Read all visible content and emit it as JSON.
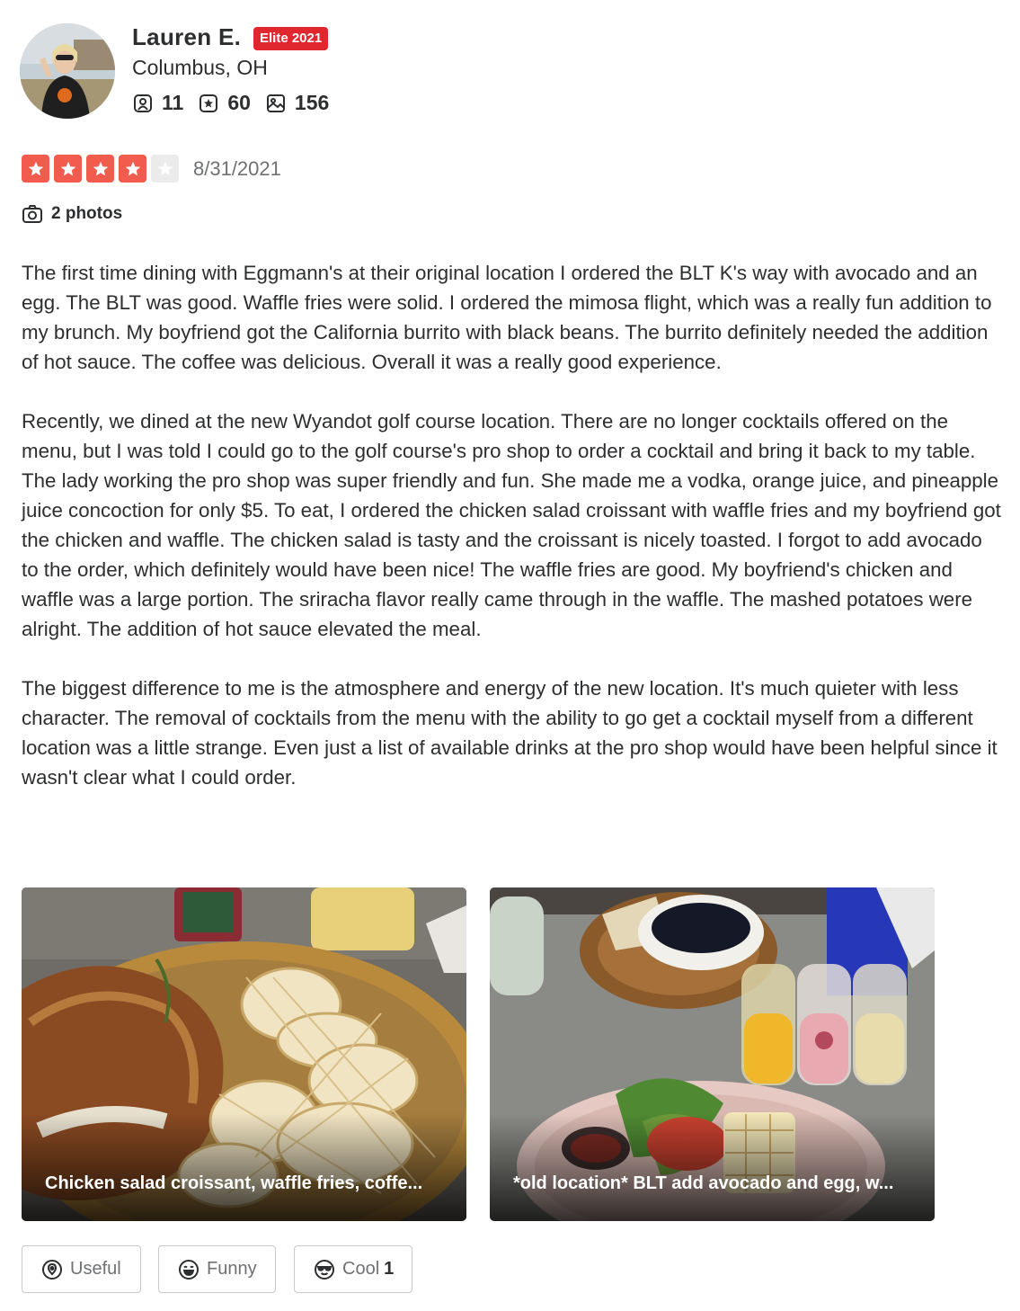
{
  "user": {
    "name": "Lauren E.",
    "badge": "Elite 2021",
    "location": "Columbus, OH",
    "friends": "11",
    "reviews": "60",
    "photos": "156"
  },
  "review": {
    "rating": 4,
    "rating_max": 5,
    "date": "8/31/2021",
    "photos_label": "2 photos",
    "paragraphs": [
      "The first time dining with Eggmann's at their original location I ordered the BLT K's way with avocado and an egg. The BLT was good. Waffle fries were solid. I ordered the mimosa flight, which was a really fun addition to my brunch. My boyfriend got the California burrito with black beans. The burrito definitely needed the addition of hot sauce. The coffee was delicious. Overall it was a really good experience.",
      "Recently, we dined at the new Wyandot golf course location. There are no longer cocktails offered on the menu, but I was told I could go to the golf course's pro shop to order a cocktail and bring it back to my table. The lady working the pro shop was super friendly and fun. She made me a vodka, orange juice, and pineapple juice concoction for only $5. To eat, I ordered the chicken salad croissant with waffle fries and my boyfriend got the chicken and waffle. The chicken salad is tasty and the croissant is nicely toasted. I forgot to add avocado to the order, which definitely would have been nice! The waffle fries are good. My boyfriend's chicken and waffle was a large portion. The sriracha flavor really came through in the waffle. The mashed potatoes were alright. The addition of hot sauce elevated the meal.",
      "The biggest difference to me is the atmosphere and energy of the new location. It's much quieter with less character. The removal of cocktails from the menu with the ability to go get a cocktail myself from a different location was a little strange. Even just a list of available drinks at the pro shop would have been helpful since it wasn't clear what I could order."
    ]
  },
  "photos": [
    {
      "caption": "Chicken salad croissant, waffle fries, coffe..."
    },
    {
      "caption": "*old location* BLT add avocado and egg, w..."
    }
  ],
  "reactions": {
    "useful": {
      "label": "Useful",
      "count": ""
    },
    "funny": {
      "label": "Funny",
      "count": ""
    },
    "cool": {
      "label": "Cool",
      "count": "1"
    }
  },
  "colors": {
    "star": "#f15c4f",
    "star_empty": "#ebebeb",
    "elite": "#e0272f",
    "text": "#2d2e2f",
    "muted": "#6e7072"
  },
  "icons": [
    "friends-icon",
    "review-count-icon",
    "photo-count-icon",
    "camera-icon",
    "useful-icon",
    "funny-icon",
    "cool-icon"
  ]
}
